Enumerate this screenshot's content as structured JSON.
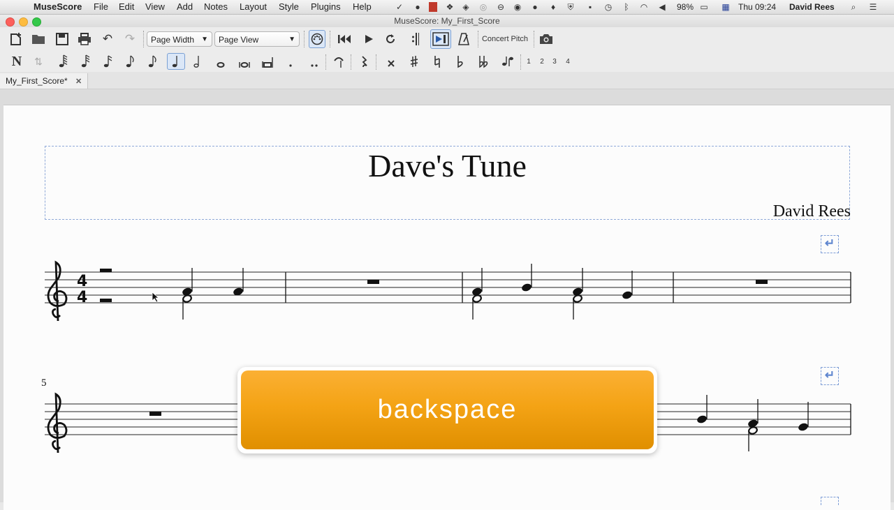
{
  "menubar": {
    "apple": "",
    "app_name": "MuseScore",
    "items": [
      "File",
      "Edit",
      "View",
      "Add",
      "Notes",
      "Layout",
      "Style",
      "Plugins",
      "Help"
    ],
    "battery": "98%",
    "clock": "Thu 09:24",
    "user": "David Rees"
  },
  "window": {
    "title": "MuseScore: My_First_Score"
  },
  "toolbar": {
    "zoom_value": "Page Width",
    "view_mode": "Page View",
    "concert_pitch": "Concert Pitch",
    "voices": [
      "1",
      "2",
      "3",
      "4"
    ]
  },
  "tabs": [
    {
      "label": "My_First_Score*",
      "close": "✕"
    }
  ],
  "score": {
    "title": "Dave's Tune",
    "composer": "David Rees",
    "time_signature": {
      "top": "4",
      "bottom": "4"
    },
    "system2_first_measure": "5",
    "break_symbol": "↵"
  },
  "overlay": {
    "key_label": "backspace"
  },
  "colors": {
    "overlay_orange": "#f4a315",
    "frame_blue": "#8fa9d8",
    "brand_red": "#c0392b"
  }
}
